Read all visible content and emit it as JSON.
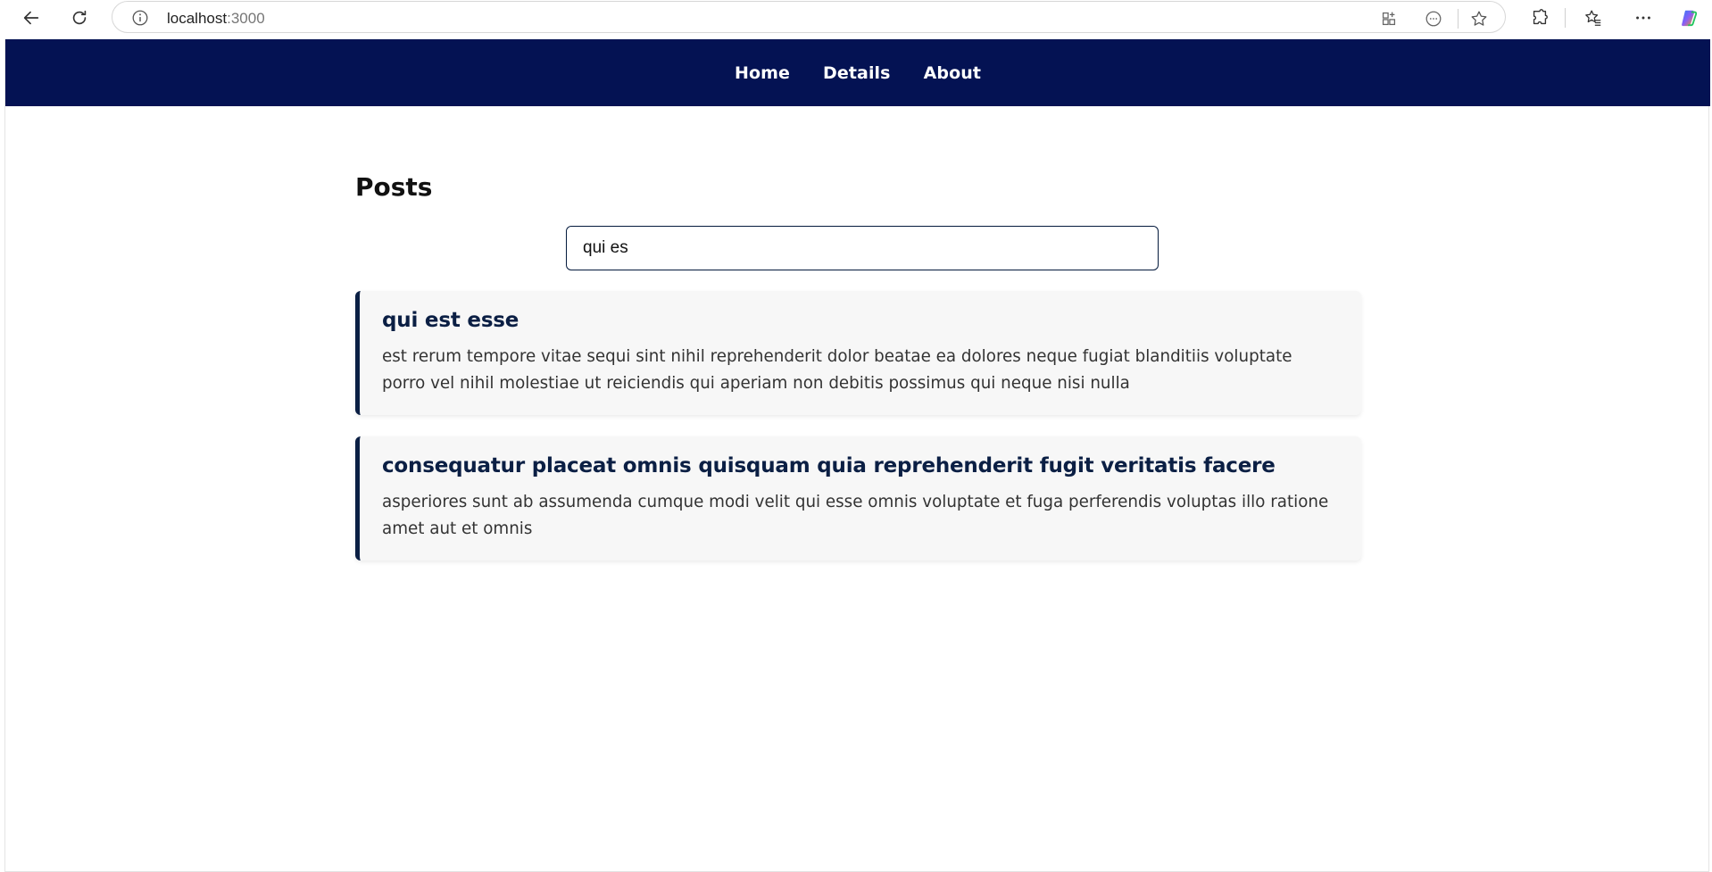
{
  "browser": {
    "url_host": "localhost",
    "url_port": ":3000"
  },
  "nav": {
    "items": [
      {
        "label": "Home"
      },
      {
        "label": "Details"
      },
      {
        "label": "About"
      }
    ]
  },
  "main": {
    "title": "Posts",
    "search": {
      "value": "qui es"
    },
    "posts": [
      {
        "title": "qui est esse",
        "body": "est rerum tempore vitae sequi sint nihil reprehenderit dolor beatae ea dolores neque fugiat blanditiis voluptate porro vel nihil molestiae ut reiciendis qui aperiam non debitis possimus qui neque nisi nulla"
      },
      {
        "title": "consequatur placeat omnis quisquam quia reprehenderit fugit veritatis facere",
        "body": "asperiores sunt ab assumenda cumque modi velit qui esse omnis voluptate et fuga perferendis voluptas illo ratione amet aut et omnis"
      }
    ]
  },
  "colors": {
    "nav_background": "#041253",
    "card_accent": "#0b1f44",
    "card_background": "#f7f7f7"
  },
  "icons": [
    "back-arrow-icon",
    "refresh-icon",
    "site-info-icon",
    "app-grid-icon",
    "read-aloud-icon",
    "favorite-star-icon",
    "extensions-icon",
    "favorites-collection-icon",
    "more-options-icon",
    "copilot-icon"
  ]
}
